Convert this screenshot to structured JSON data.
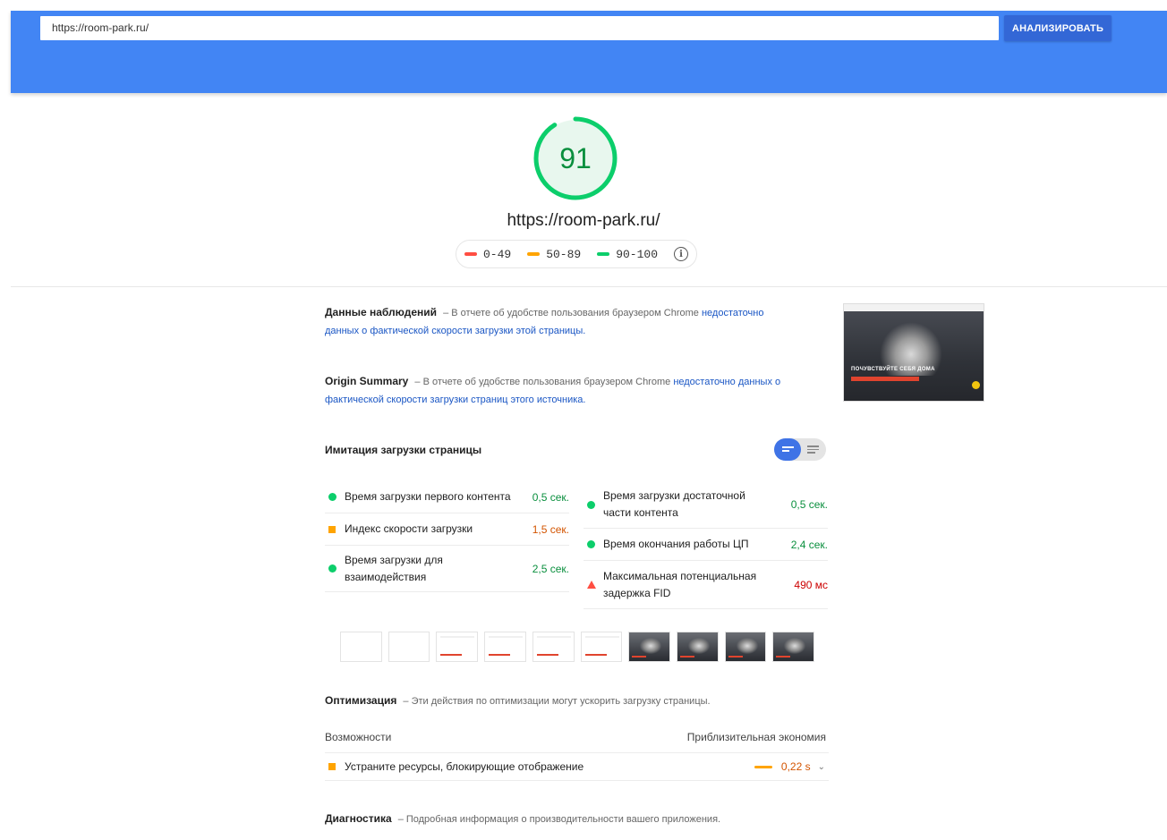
{
  "header": {
    "url_value": "https://room-park.ru/",
    "analyze_label": "АНАЛИЗИРОВАТЬ"
  },
  "score": {
    "value": "91",
    "fraction": 0.91,
    "color": "#0cce6b",
    "url": "https://room-park.ru/"
  },
  "legend": {
    "items": [
      {
        "label": "0-49",
        "color": "#ff4e42"
      },
      {
        "label": "50-89",
        "color": "#ffa400"
      },
      {
        "label": "90-100",
        "color": "#0cce6b"
      }
    ],
    "info_icon": "info-icon"
  },
  "field_data": {
    "title": "Данные наблюдений",
    "text": "– В отчете об удобстве пользования браузером Chrome ",
    "link": "недостаточно данных о фактической скорости загрузки этой страницы."
  },
  "origin_summary": {
    "title": "Origin Summary",
    "text": "– В отчете об удобстве пользования браузером Chrome ",
    "link": "недостаточно данных о фактической скорости загрузки страниц этого источника."
  },
  "screenshot_caption": "ПОЧУВСТВУЙТЕ СЕБЯ ДОМА",
  "lab": {
    "title": "Имитация загрузки страницы",
    "left": [
      {
        "label": "Время загрузки первого контента",
        "value": "0,5 сек.",
        "status": "pass"
      },
      {
        "label": "Индекс скорости загрузки",
        "value": "1,5 сек.",
        "status": "average"
      },
      {
        "label": "Время загрузки для взаимодействия",
        "value": "2,5 сек.",
        "status": "pass"
      }
    ],
    "right": [
      {
        "label": "Время загрузки достаточной части контента",
        "value": "0,5 сек.",
        "status": "pass"
      },
      {
        "label": "Время окончания работы ЦП",
        "value": "2,4 сек.",
        "status": "pass"
      },
      {
        "label": "Максимальная потенциальная задержка FID",
        "value": "490 мс",
        "status": "fail"
      }
    ]
  },
  "optimization": {
    "title": "Оптимизация",
    "text": "– Эти действия по оптимизации могут ускорить загрузку страницы.",
    "col_left": "Возможности",
    "col_right": "Приблизительная экономия",
    "items": [
      {
        "label": "Устраните ресурсы, блокирующие отображение",
        "value": "0,22 s"
      }
    ]
  },
  "diagnostics": {
    "title": "Диагностика",
    "text": "– Подробная информация о производительности вашего приложения."
  }
}
